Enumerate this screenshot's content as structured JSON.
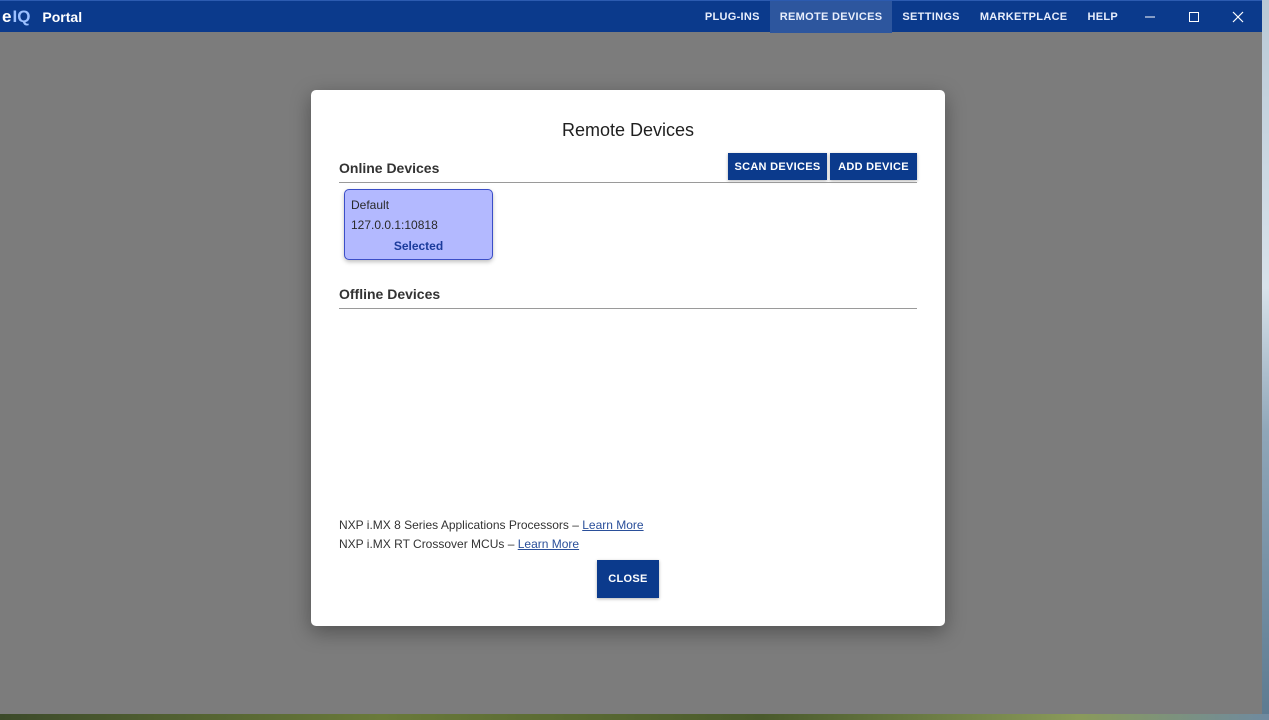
{
  "app": {
    "logo_e": "e",
    "logo_iq": "IQ",
    "title": "Portal"
  },
  "nav": {
    "items": [
      {
        "label": "PLUG-INS"
      },
      {
        "label": "REMOTE DEVICES",
        "active": true
      },
      {
        "label": "SETTINGS"
      },
      {
        "label": "MARKETPLACE"
      },
      {
        "label": "HELP"
      }
    ]
  },
  "window_controls": [
    "minimize-icon",
    "maximize-icon",
    "close-icon"
  ],
  "modal": {
    "title": "Remote Devices",
    "online_section": "Online Devices",
    "offline_section": "Offline Devices",
    "scan_button": "SCAN DEVICES",
    "add_button": "ADD DEVICE",
    "devices": [
      {
        "name": "Default",
        "address": "127.0.0.1:10818",
        "status": "Selected"
      }
    ],
    "links": [
      {
        "text": "NXP i.MX 8 Series Applications Processors – ",
        "link": "Learn More"
      },
      {
        "text": "NXP i.MX RT Crossover MCUs – ",
        "link": "Learn More"
      }
    ],
    "close_button": "CLOSE"
  },
  "colors": {
    "brand": "#0b3a8c",
    "selected_card": "#b3b9ff",
    "overlay": "#7c7c7c"
  }
}
